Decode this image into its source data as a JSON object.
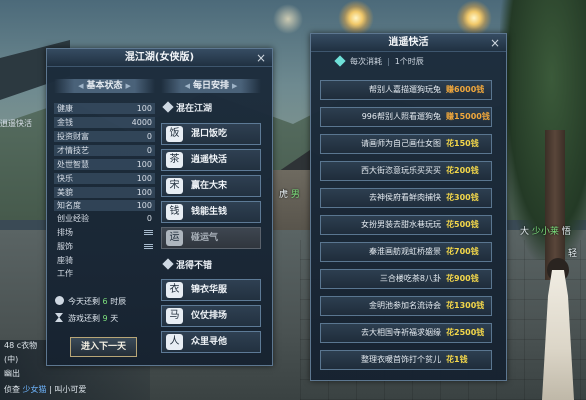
{
  "scene": {
    "name_tag_left": {
      "prefix": "虎",
      "gender": "男"
    },
    "name_tag_right": {
      "prefix": "大",
      "name": "少小莱",
      "suffix": "悟"
    },
    "name_tag_right2": "轻",
    "left_side_text": "逍遥快活"
  },
  "chat": {
    "lines": [
      {
        "text": "48 c衣物"
      },
      {
        "text": "(中)"
      },
      {
        "text": "幽出"
      },
      {
        "prefix": "侦查",
        "name": "少女猫",
        "suffix": "| 叫小可爱"
      }
    ]
  },
  "left_panel": {
    "title": "混江湖(女侠版)",
    "close_label": "×",
    "basic_status": {
      "title": "基本状态"
    },
    "daily_schedule": {
      "title": "每日安排"
    },
    "stats": [
      {
        "label": "健康",
        "value": "100"
      },
      {
        "label": "金钱",
        "value": "4000"
      },
      {
        "label": "投资财富",
        "value": "0"
      },
      {
        "label": "才情技艺",
        "value": "0"
      },
      {
        "label": "处世智慧",
        "value": "100"
      },
      {
        "label": "快乐",
        "value": "100"
      },
      {
        "label": "美貌",
        "value": "100"
      },
      {
        "label": "知名度",
        "value": "100"
      },
      {
        "label": "创业经验",
        "value": "0"
      },
      {
        "label": "排场",
        "value": "",
        "icon": "list-icon"
      },
      {
        "label": "服饰",
        "value": "",
        "icon": "list-icon"
      },
      {
        "label": "座骑",
        "value": ""
      },
      {
        "label": "工作",
        "value": ""
      }
    ],
    "time": {
      "today_label": "今天还剩",
      "today_num": "6",
      "today_unit": "时辰",
      "game_label": "游戏还剩",
      "game_num": "9",
      "game_unit": "天"
    },
    "next_day_button": "进入下一天",
    "groups": [
      {
        "title": "混在江湖",
        "items": [
          {
            "label": "混口饭吃",
            "icon": "bowl-icon",
            "glyph": "饭",
            "enabled": true
          },
          {
            "label": "逍遥快活",
            "icon": "teacup-icon",
            "glyph": "茶",
            "enabled": true
          },
          {
            "label": "赢在大宋",
            "icon": "shop-icon",
            "glyph": "宋",
            "enabled": true
          },
          {
            "label": "钱能生钱",
            "icon": "money-bag-icon",
            "glyph": "钱",
            "enabled": true
          },
          {
            "label": "碰运气",
            "icon": "dice-icon",
            "glyph": "运",
            "enabled": false
          }
        ]
      },
      {
        "title": "混得不错",
        "items": [
          {
            "label": "锦衣华服",
            "icon": "robe-icon",
            "glyph": "衣",
            "enabled": true
          },
          {
            "label": "仪仗排场",
            "icon": "horse-icon",
            "glyph": "马",
            "enabled": true
          },
          {
            "label": "众里寻他",
            "icon": "couple-icon",
            "glyph": "人",
            "enabled": true
          }
        ]
      }
    ]
  },
  "right_panel": {
    "title": "逍遥快活",
    "close_label": "×",
    "cost": {
      "label": "每次消耗",
      "value": "1个时辰"
    },
    "tasks": [
      {
        "label": "帮别人嘉描遛狗玩兔",
        "reward": "赚6000钱",
        "kind": "earn"
      },
      {
        "label": "996帮别人照看遛狗兔",
        "reward": "赚15000钱",
        "kind": "earn"
      },
      {
        "label": "请画师为自己画仕女图",
        "reward": "花150钱",
        "kind": "spend"
      },
      {
        "label": "西大街恣意玩乐买买买",
        "reward": "花200钱",
        "kind": "spend"
      },
      {
        "label": "去神侯府看鲜肉捕快",
        "reward": "花300钱",
        "kind": "spend"
      },
      {
        "label": "女扮男装去甜水巷玩玩",
        "reward": "花500钱",
        "kind": "spend"
      },
      {
        "label": "秦淮画舫观虹桥盛景",
        "reward": "花700钱",
        "kind": "spend"
      },
      {
        "label": "三合楼吃茶8八卦",
        "reward": "花900钱",
        "kind": "spend"
      },
      {
        "label": "金明池参加名流诗会",
        "reward": "花1300钱",
        "kind": "spend"
      },
      {
        "label": "去大相国寺祈福求姻缘",
        "reward": "花2500钱",
        "kind": "spend"
      },
      {
        "label": "整理衣暖首饰打个贫儿",
        "reward": "花1钱",
        "kind": "spend"
      }
    ]
  },
  "colors": {
    "earn": "#f0a73c",
    "spend": "#f2d64a",
    "time_num": "#7de07d",
    "panel_border": "#5d7790",
    "button_gold_border": "#b8a677"
  }
}
